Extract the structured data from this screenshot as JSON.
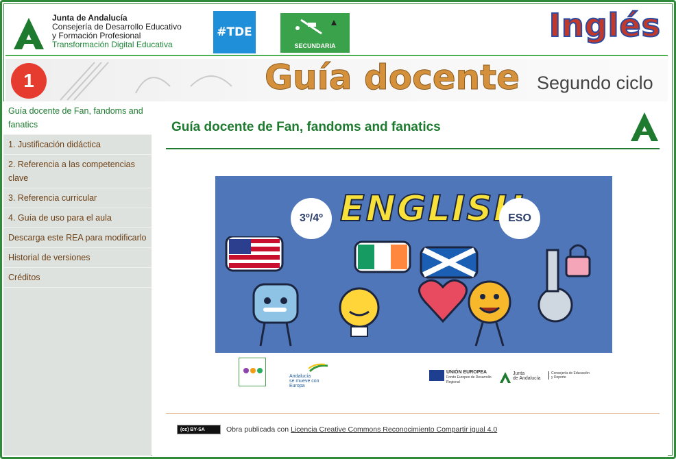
{
  "header": {
    "org_name": "Junta de Andalucía",
    "org_line2": "Consejería de Desarrollo Educativo",
    "org_line3": "y Formación Profesional",
    "org_line4": "Transformación Digital Educativa",
    "tde_badge": "#TDE",
    "level_badge": "SECUNDARIA",
    "subject": "Inglés"
  },
  "banner": {
    "number": "1",
    "title": "Guía docente",
    "cycle": "Segundo ciclo"
  },
  "sidebar": {
    "items": [
      {
        "label": "Guía docente de Fan, fandoms and fanatics"
      },
      {
        "label": "1. Justificación didáctica"
      },
      {
        "label": "2. Referencia a las competencias clave"
      },
      {
        "label": "3. Referencia curricular"
      },
      {
        "label": "4. Guía de uso para el aula"
      },
      {
        "label": "Descarga este REA para modificarlo"
      },
      {
        "label": "Historial de versiones"
      },
      {
        "label": "Créditos"
      }
    ]
  },
  "main": {
    "title": "Guía docente de Fan, fandoms and fanatics",
    "hero": {
      "grade": "3º/4º",
      "word": "ENGLISH",
      "stage": "ESO"
    },
    "logos": {
      "andalucia_1": "Andalucía",
      "andalucia_2": "se mueve con Europa",
      "ue_1": "UNIÓN EUROPEA",
      "ue_2": "Fondo Europeo de Desarrollo Regional",
      "ja_1": "Junta",
      "ja_2": "de Andalucía",
      "ja_3": "Consejería de Educación y Deporte"
    },
    "license": {
      "badge": "BY-SA",
      "prefix": "Obra publicada con",
      "link": "Licencia Creative Commons Reconocimiento Compartir igual 4.0"
    }
  },
  "colors": {
    "green": "#1d7a2e",
    "sidebar_bg": "#dee2df",
    "nav_text": "#6b3f14",
    "hero_bg": "#4f76b9",
    "guia_orange": "#d4903a",
    "ingles_red": "#c0392b"
  }
}
